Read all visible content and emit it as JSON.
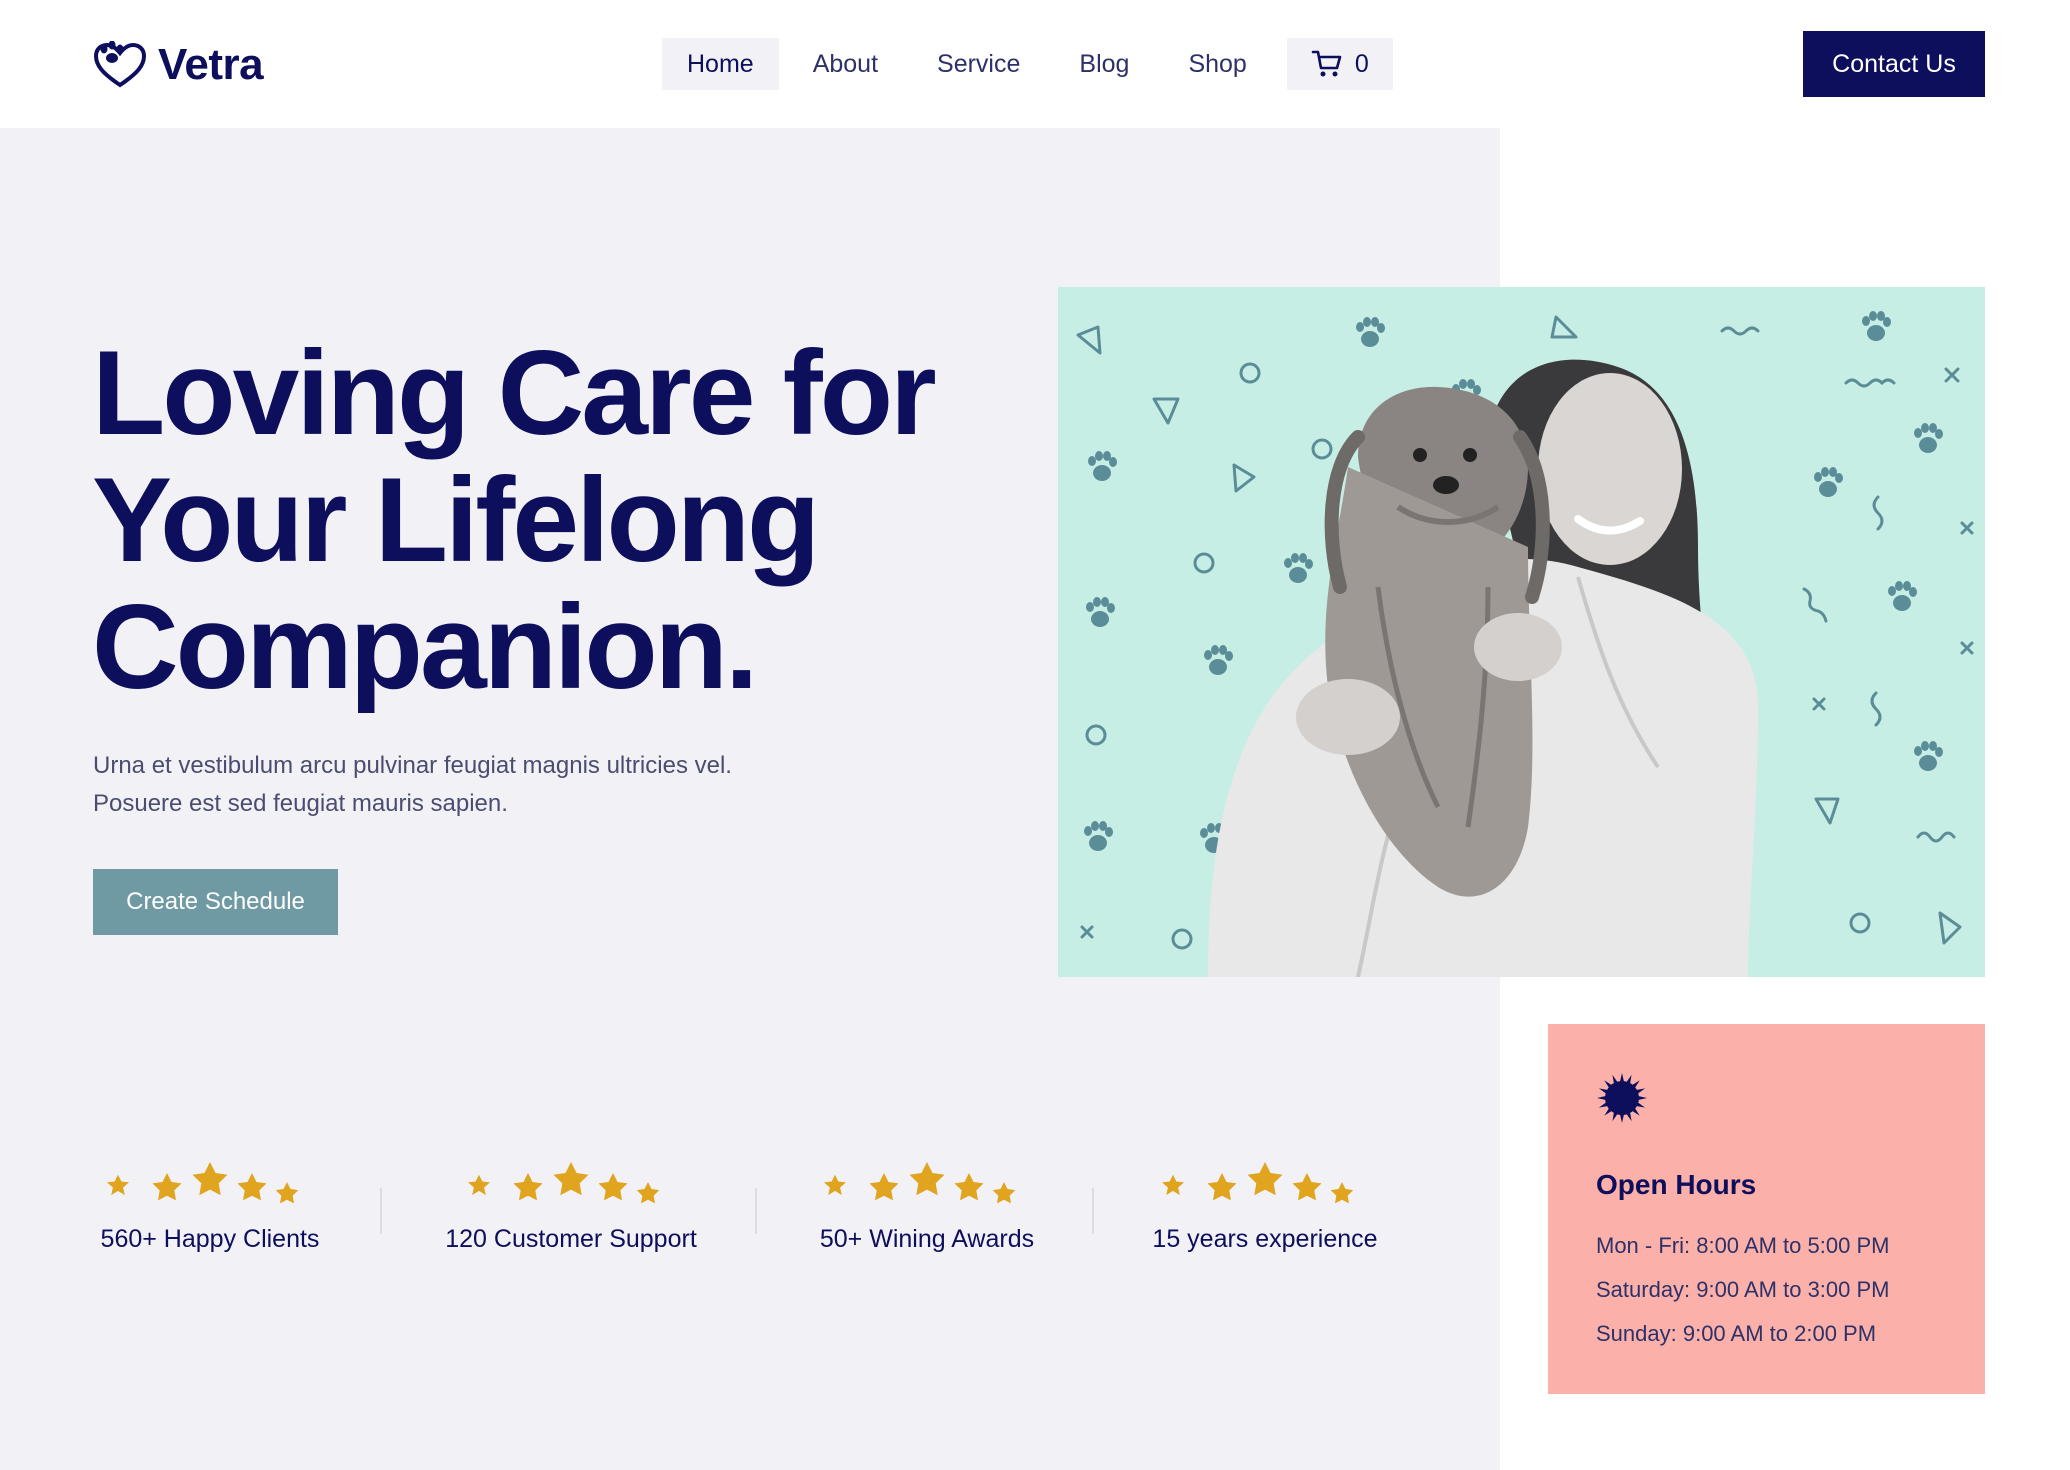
{
  "brand": {
    "name": "Vetra"
  },
  "nav": {
    "items": [
      {
        "label": "Home",
        "active": true
      },
      {
        "label": "About"
      },
      {
        "label": "Service"
      },
      {
        "label": "Blog"
      },
      {
        "label": "Shop"
      }
    ],
    "cart_count": "0",
    "contact_label": "Contact Us"
  },
  "hero": {
    "title_lines": [
      "Loving Care for",
      "Your Lifelong",
      "Companion."
    ],
    "description": "Urna et vestibulum arcu pulvinar feugiat magnis ultricies vel. Posuere est sed feugiat mauris sapien.",
    "cta_label": "Create Schedule"
  },
  "stats": [
    {
      "label": "560+ Happy Clients"
    },
    {
      "label": "120 Customer Support"
    },
    {
      "label": "50+ Wining Awards"
    },
    {
      "label": "15 years experience"
    }
  ],
  "hours": {
    "title": "Open Hours",
    "lines": [
      "Mon - Fri: 8:00 AM to 5:00 PM",
      "Saturday: 9:00 AM to 3:00 PM",
      "Sunday: 9:00 AM to 2:00 PM"
    ]
  },
  "colors": {
    "navy": "#0d0e5c",
    "teal_button": "#6f9aa3",
    "mint": "#c7eee5",
    "coral": "#fbb1a9",
    "star": "#e0a41e",
    "hero_bg": "#f2f2f6"
  },
  "icons": {
    "logo": "paw-heart-icon",
    "cart": "cart-icon",
    "hours_badge": "starburst-icon",
    "rating": "star-icon"
  }
}
